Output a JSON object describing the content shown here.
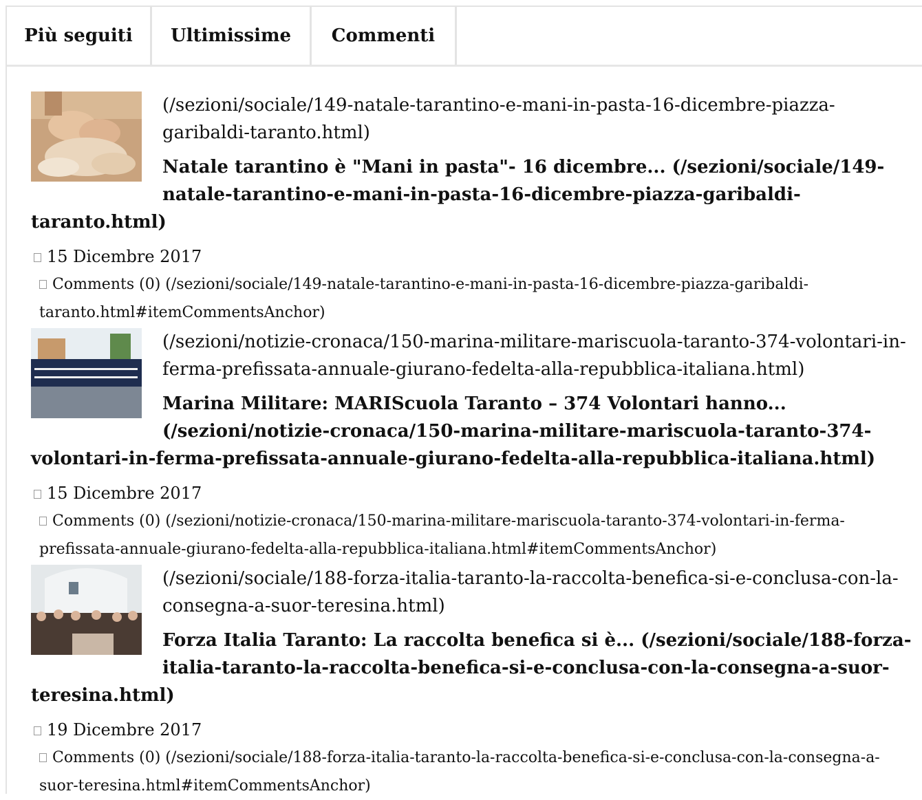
{
  "tabs": [
    {
      "label": "Più seguiti"
    },
    {
      "label": "Ultimissime"
    },
    {
      "label": "Commenti"
    }
  ],
  "articles": [
    {
      "url": "(/sezioni/sociale/149-natale-tarantino-e-mani-in-pasta-16-dicembre-piazza-garibaldi-taranto.html)",
      "title": "Natale tarantino è \"Mani in pasta\"- 16 dicembre... (/sezioni/sociale/149-natale-tarantino-e-mani-in-pasta-16-dicembre-piazza-garibaldi-taranto.html)",
      "date": "15 Dicembre 2017",
      "comments": "Comments (0) (/sezioni/sociale/149-natale-tarantino-e-mani-in-pasta-16-dicembre-piazza-garibaldi-taranto.html#itemCommentsAnchor)"
    },
    {
      "url": "(/sezioni/notizie-cronaca/150-marina-militare-mariscuola-taranto-374-volontari-in-ferma-prefissata-annuale-giurano-fedelta-alla-repubblica-italiana.html)",
      "title": "Marina Militare: MARIScuola Taranto – 374 Volontari hanno... (/sezioni/notizie-cronaca/150-marina-militare-mariscuola-taranto-374-volontari-in-ferma-prefissata-annuale-giurano-fedelta-alla-repubblica-italiana.html)",
      "date": "15 Dicembre 2017",
      "comments": "Comments (0) (/sezioni/notizie-cronaca/150-marina-militare-mariscuola-taranto-374-volontari-in-ferma-prefissata-annuale-giurano-fedelta-alla-repubblica-italiana.html#itemCommentsAnchor)"
    },
    {
      "url": "(/sezioni/sociale/188-forza-italia-taranto-la-raccolta-benefica-si-e-conclusa-con-la-consegna-a-suor-teresina.html)",
      "title": "Forza Italia Taranto: La raccolta benefica si è... (/sezioni/sociale/188-forza-italia-taranto-la-raccolta-benefica-si-e-conclusa-con-la-consegna-a-suor-teresina.html)",
      "date": "19 Dicembre 2017",
      "comments": "Comments (0) (/sezioni/sociale/188-forza-italia-taranto-la-raccolta-benefica-si-e-conclusa-con-la-consegna-a-suor-teresina.html#itemCommentsAnchor)"
    }
  ],
  "icons": {
    "date": "calendar-icon",
    "comments": "comment-icon"
  }
}
